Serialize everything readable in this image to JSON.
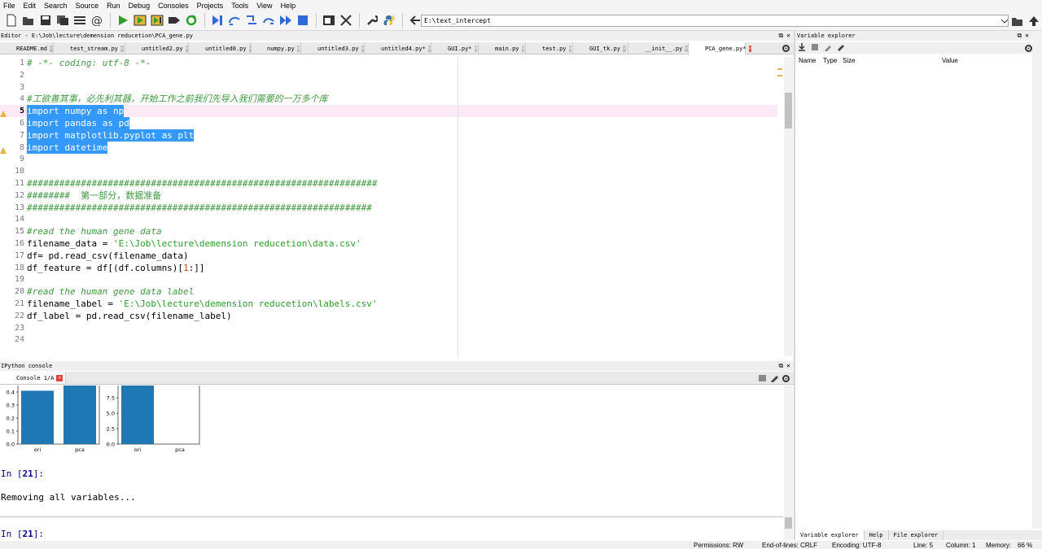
{
  "menu": [
    "File",
    "Edit",
    "Search",
    "Source",
    "Run",
    "Debug",
    "Consoles",
    "Projects",
    "Tools",
    "View",
    "Help"
  ],
  "toolbar": {
    "working_directory": "E:\\text_intercept",
    "icons": [
      "new-file-icon",
      "open-file-icon",
      "save-icon",
      "save-all-icon",
      "outline-icon",
      "email-icon",
      "run-icon",
      "run-cell-icon",
      "run-cell-advance-icon",
      "run-selection-icon",
      "rerun-icon",
      "debug-icon",
      "step-icon",
      "step-into-icon",
      "continue-icon",
      "stop-icon",
      "maximize-icon",
      "fullscreen-icon",
      "preferences-icon",
      "python-path-icon",
      "back-icon",
      "browse-folder-icon",
      "parent-dir-icon"
    ]
  },
  "editor": {
    "header": "Editor - E:\\Job\\lecture\\demension reducetion\\PCA_gene.py",
    "tabs": [
      "README.md",
      "test_stream.py",
      "untitled2.py",
      "untitled0.py",
      "numpy.py",
      "untitled3.py",
      "untitled4.py*",
      "GUI.py*",
      "main.py",
      "test.py",
      "GUI_tk.py",
      "__init__.py",
      "PCA_gene.py*"
    ],
    "active_tab": "PCA_gene.py*",
    "lines": [
      {
        "n": "1",
        "t": "# -*- coding: utf-8 -*-"
      },
      {
        "n": "2",
        "t": ""
      },
      {
        "n": "3",
        "t": ""
      },
      {
        "n": "4",
        "t": "#工欲善其事，必先利其器，开始工作之前我们先导入我们需要的一万多个库"
      },
      {
        "n": "5",
        "t": "import numpy as np"
      },
      {
        "n": "6",
        "t": "import pandas as pd"
      },
      {
        "n": "7",
        "t": "import matplotlib.pyplot as plt"
      },
      {
        "n": "8",
        "t": "import datetime"
      },
      {
        "n": "9",
        "t": ""
      },
      {
        "n": "10",
        "t": ""
      },
      {
        "n": "11",
        "t": "#################################################################"
      },
      {
        "n": "12",
        "t": "########  第一部分，数据准备"
      },
      {
        "n": "13",
        "t": "################################################################"
      },
      {
        "n": "14",
        "t": ""
      },
      {
        "n": "15",
        "t": "#read the human gene data"
      },
      {
        "n": "16",
        "t": "filename_data = 'E:\\Job\\lecture\\demension reducetion\\data.csv'"
      },
      {
        "n": "17",
        "t": "df= pd.read_csv(filename_data)"
      },
      {
        "n": "18",
        "t": "df_feature = df[(df.columns)[1:]]"
      },
      {
        "n": "19",
        "t": ""
      },
      {
        "n": "20",
        "t": "#read the human gene data label"
      },
      {
        "n": "21",
        "t": "filename_label = 'E:\\Job\\lecture\\demension reducetion\\labels.csv'"
      },
      {
        "n": "22",
        "t": "df_label = pd.read_csv(filename_label)"
      },
      {
        "n": "23",
        "t": ""
      },
      {
        "n": "24",
        "t": ""
      }
    ]
  },
  "console": {
    "header": "IPython console",
    "tab": "Console 1/A",
    "prompt1": "In [21]:",
    "output": "Removing all variables...",
    "prompt2": "In [21]:",
    "prompt_label": "In [",
    "prompt_num": "21",
    "prompt_end": "]:"
  },
  "chart_data": [
    {
      "type": "bar",
      "categories": [
        "ori",
        "pca"
      ],
      "values": [
        0.41,
        0.45
      ],
      "yticks": [
        "0.0",
        "0.1",
        "0.2",
        "0.3",
        "0.4"
      ],
      "ylim": [
        0,
        0.45
      ]
    },
    {
      "type": "bar",
      "categories": [
        "ori",
        "pca"
      ],
      "values": [
        9.5,
        0
      ],
      "yticks": [
        "0.0",
        "2.5",
        "5.0",
        "7.5"
      ],
      "ylim": [
        0,
        9.5
      ]
    }
  ],
  "variable_explorer": {
    "header": "Variable explorer",
    "columns": [
      "Name",
      "Type",
      "Size",
      "Value"
    ],
    "bottom_tabs": [
      "Variable explorer",
      "Help",
      "File explorer"
    ]
  },
  "status": {
    "permissions": "Permissions: RW",
    "eol": "End-of-lines: CRLF",
    "encoding": "Encoding: UTF-8",
    "line": "Line: 5",
    "column": "Column: 1",
    "memory_label": "Memory:",
    "memory": "66 %"
  },
  "colors": {
    "bar": "#1f77b4",
    "selection": "#3399ff",
    "comment": "#3f9a3f",
    "close_active": "#e0423c"
  }
}
